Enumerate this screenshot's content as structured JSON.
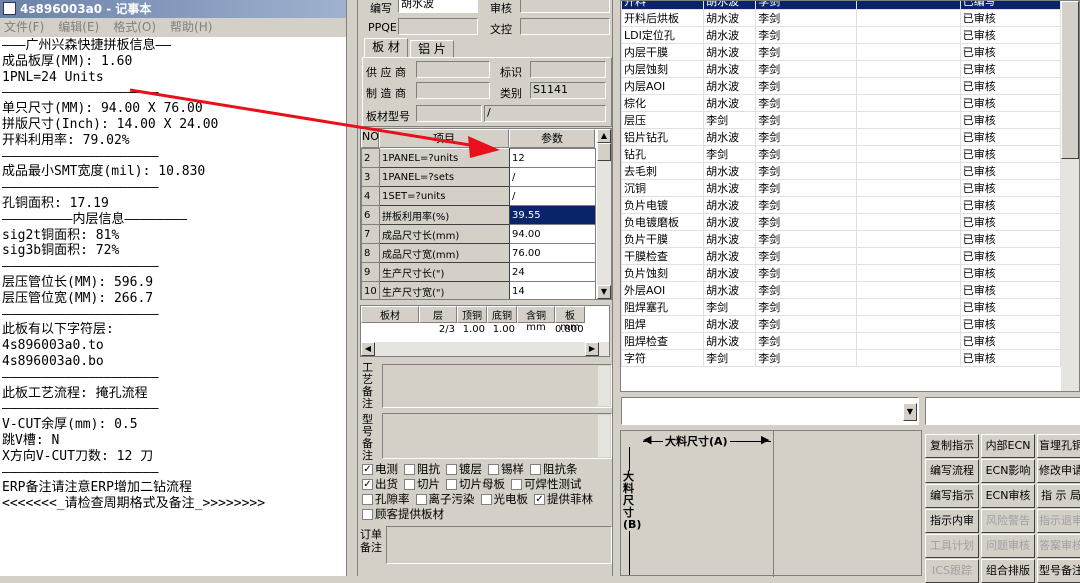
{
  "notepad": {
    "title": "4s896003a0 - 记事本",
    "menu": [
      "文件(F)",
      "编辑(E)",
      "格式(O)",
      "帮助(H)"
    ],
    "lines": [
      "———广州兴森快捷拼板信息——",
      "成品板厚(MM): 1.60",
      "1PNL=24 Units",
      "————————————————————",
      "单只尺寸(MM): 94.00 X 76.00",
      "拼版尺寸(Inch): 14.00 X 24.00",
      "开料利用率: 79.02%",
      "————————————————————",
      "成品最小SMT宽度(mil): 10.830",
      "————————————————————",
      "孔铜面积: 17.19",
      "—————————内层信息————————",
      "sig2t铜面积: 81%",
      "sig3b铜面积: 72%",
      "————————————————————",
      "层压管位长(MM): 596.9",
      "层压管位宽(MM): 266.7",
      "————————————————————",
      "此板有以下字符层:",
      "4s896003a0.to",
      "4s896003a0.bo",
      "————————————————————",
      "此板工艺流程: 掩孔流程",
      "————————————————————",
      "V-CUT余厚(mm): 0.5",
      "跳V槽: N",
      "X方向V-CUT刀数: 12 刀",
      "————————————————————",
      "ERP备注请注意ERP增加二钻流程",
      "<<<<<<<_请检查周期格式及备注_>>>>>>>>"
    ]
  },
  "form": {
    "bianxie_label": "编写",
    "bianxie_value": "胡水波",
    "shenhe_label": "审核",
    "ppqe_label": "PPQE",
    "wenkong_label": "文控",
    "tab_bancai": "板 材",
    "tab_lupian": "铝 片",
    "supplier_label": "供 应 商",
    "biaoshi_label": "标识",
    "maker_label": "制 造 商",
    "leibie_label": "类别",
    "leibie_value": "S1141",
    "bancai_xinghao_label": "板材型号",
    "bancai_xinghao_value2": "/"
  },
  "param_table": {
    "headers": [
      "NO",
      "项目",
      "参数"
    ],
    "rows": [
      {
        "no": "2",
        "item": "1PANEL=?units",
        "val": "12"
      },
      {
        "no": "3",
        "item": "1PANEL=?sets",
        "val": "/"
      },
      {
        "no": "4",
        "item": "1SET=?units",
        "val": "/"
      },
      {
        "no": "6",
        "item": "拼板利用率(%)",
        "val": "39.55"
      },
      {
        "no": "7",
        "item": "成品尺寸长(mm)",
        "val": "94.00"
      },
      {
        "no": "8",
        "item": "成品尺寸宽(mm)",
        "val": "76.00"
      },
      {
        "no": "9",
        "item": "生产尺寸长(\")",
        "val": "24"
      },
      {
        "no": "10",
        "item": "生产尺寸宽(\")",
        "val": "14"
      }
    ]
  },
  "layer_table": {
    "headers": [
      "板材",
      "层",
      "顶铜",
      "底铜",
      "含铜mm",
      "板mm"
    ],
    "row": [
      "",
      "2/3",
      "1.00",
      "1.00",
      "",
      "0.800"
    ]
  },
  "remarks": {
    "gongyi_label": "工艺备注",
    "xinghao_label": "型号备注",
    "dingdan_label": "订单备注"
  },
  "checkboxes": [
    [
      {
        "label": "电测",
        "checked": true
      },
      {
        "label": "阻抗",
        "checked": false
      },
      {
        "label": "镀层",
        "checked": false
      },
      {
        "label": "锡样",
        "checked": false
      },
      {
        "label": "阻抗条",
        "checked": false
      }
    ],
    [
      {
        "label": "出货",
        "checked": true
      },
      {
        "label": "切片",
        "checked": false
      },
      {
        "label": "切片母板",
        "checked": false
      },
      {
        "label": "可焊性测试",
        "checked": false
      }
    ],
    [
      {
        "label": "孔隙率",
        "checked": false
      },
      {
        "label": "离子污染",
        "checked": false
      },
      {
        "label": "光电板",
        "checked": false
      },
      {
        "label": "提供菲林",
        "checked": true
      }
    ],
    [
      {
        "label": "顾客提供板材",
        "checked": false
      }
    ]
  ],
  "process_list": {
    "rows": [
      {
        "name": "开料",
        "a": "胡水波",
        "b": "李剑",
        "status": "已编写",
        "sel": true
      },
      {
        "name": "开料后烘板",
        "a": "胡水波",
        "b": "李剑",
        "status": "已审核"
      },
      {
        "name": "LDI定位孔",
        "a": "胡水波",
        "b": "李剑",
        "status": "已审核"
      },
      {
        "name": "内层干膜",
        "a": "胡水波",
        "b": "李剑",
        "status": "已审核"
      },
      {
        "name": "内层蚀刻",
        "a": "胡水波",
        "b": "李剑",
        "status": "已审核"
      },
      {
        "name": "内层AOI",
        "a": "胡水波",
        "b": "李剑",
        "status": "已审核"
      },
      {
        "name": "棕化",
        "a": "胡水波",
        "b": "李剑",
        "status": "已审核"
      },
      {
        "name": "层压",
        "a": "李剑",
        "b": "李剑",
        "status": "已审核"
      },
      {
        "name": "铝片钻孔",
        "a": "胡水波",
        "b": "李剑",
        "status": "已审核"
      },
      {
        "name": "钻孔",
        "a": "李剑",
        "b": "李剑",
        "status": "已审核"
      },
      {
        "name": "去毛刺",
        "a": "胡水波",
        "b": "李剑",
        "status": "已审核"
      },
      {
        "name": "沉铜",
        "a": "胡水波",
        "b": "李剑",
        "status": "已审核"
      },
      {
        "name": "负片电镀",
        "a": "胡水波",
        "b": "李剑",
        "status": "已审核"
      },
      {
        "name": "负电镀磨板",
        "a": "胡水波",
        "b": "李剑",
        "status": "已审核"
      },
      {
        "name": "负片干膜",
        "a": "胡水波",
        "b": "李剑",
        "status": "已审核"
      },
      {
        "name": "干膜检查",
        "a": "胡水波",
        "b": "李剑",
        "status": "已审核"
      },
      {
        "name": "负片蚀刻",
        "a": "胡水波",
        "b": "李剑",
        "status": "已审核"
      },
      {
        "name": "外层AOI",
        "a": "胡水波",
        "b": "李剑",
        "status": "已审核"
      },
      {
        "name": "阻焊塞孔",
        "a": "李剑",
        "b": "李剑",
        "status": "已审核"
      },
      {
        "name": "阻焊",
        "a": "胡水波",
        "b": "李剑",
        "status": "已审核"
      },
      {
        "name": "阻焊检查",
        "a": "胡水波",
        "b": "李剑",
        "status": "已审核"
      },
      {
        "name": "字符",
        "a": "李剑",
        "b": "李剑",
        "status": "已审核"
      }
    ]
  },
  "dimension": {
    "a_label": "大料尺寸(A)",
    "b_label": "大料尺寸(B)"
  },
  "buttons": [
    [
      "复制指示",
      "内部ECN",
      "盲埋孔铜"
    ],
    [
      "编写流程",
      "ECN影响",
      "修改申请"
    ],
    [
      "编写指示",
      "ECN审核",
      "指 示 局"
    ],
    [
      "指示内审",
      "风险警告",
      "指示退审"
    ],
    [
      "工具计划",
      "问题审核",
      "答案审核"
    ],
    [
      "ICS跟踪",
      "组合排版",
      "型号备注"
    ]
  ],
  "colors": {
    "selection": "#0a246a",
    "annotation_arrow": "#e8101a"
  }
}
